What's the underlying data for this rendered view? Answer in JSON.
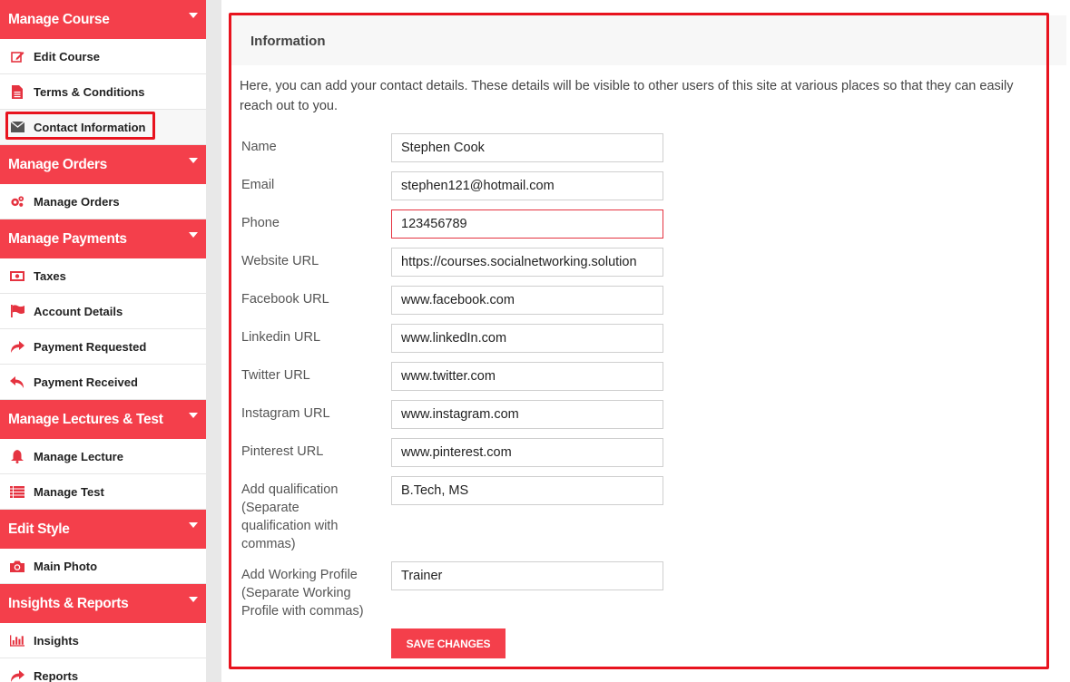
{
  "sidebar": {
    "sections": [
      {
        "title": "Manage Course",
        "items": [
          {
            "label": "Edit Course",
            "icon": "edit-icon"
          },
          {
            "label": "Terms & Conditions",
            "icon": "file-icon"
          },
          {
            "label": "Contact Information",
            "icon": "envelope-icon"
          }
        ]
      },
      {
        "title": "Manage Orders",
        "items": [
          {
            "label": "Manage Orders",
            "icon": "gears-icon"
          }
        ]
      },
      {
        "title": "Manage Payments",
        "items": [
          {
            "label": "Taxes",
            "icon": "money-icon"
          },
          {
            "label": "Account Details",
            "icon": "flag-icon"
          },
          {
            "label": "Payment Requested",
            "icon": "share-icon"
          },
          {
            "label": "Payment Received",
            "icon": "reply-icon"
          }
        ]
      },
      {
        "title": "Manage Lectures & Test",
        "items": [
          {
            "label": "Manage Lecture",
            "icon": "bell-icon"
          },
          {
            "label": "Manage Test",
            "icon": "list-icon"
          }
        ]
      },
      {
        "title": "Edit Style",
        "items": [
          {
            "label": "Main Photo",
            "icon": "camera-icon"
          }
        ]
      },
      {
        "title": "Insights & Reports",
        "items": [
          {
            "label": "Insights",
            "icon": "bar-chart-icon"
          },
          {
            "label": "Reports",
            "icon": "share-icon"
          }
        ]
      }
    ]
  },
  "main": {
    "title": "Information",
    "intro": "Here, you can add your contact details. These details will be visible to other users of this site at various places so that they can easily reach out to you.",
    "fields": {
      "name": {
        "label": "Name",
        "value": "Stephen Cook"
      },
      "email": {
        "label": "Email",
        "value": "stephen121@hotmail.com"
      },
      "phone": {
        "label": "Phone",
        "value": "123456789"
      },
      "website": {
        "label": "Website URL",
        "value": "https://courses.socialnetworking.solution"
      },
      "facebook": {
        "label": "Facebook URL",
        "value": "www.facebook.com"
      },
      "linkedin": {
        "label": "Linkedin URL",
        "value": "www.linkedIn.com"
      },
      "twitter": {
        "label": "Twitter URL",
        "value": "www.twitter.com"
      },
      "instagram": {
        "label": "Instagram URL",
        "value": "www.instagram.com"
      },
      "pinterest": {
        "label": "Pinterest URL",
        "value": "www.pinterest.com"
      },
      "qualification": {
        "label_lines": [
          "Add qualification",
          "(Separate",
          "qualification with",
          "commas)"
        ],
        "value": "B.Tech, MS"
      },
      "working_profile": {
        "label_lines": [
          "Add Working Profile",
          "(Separate Working",
          "Profile with commas)"
        ],
        "value": "Trainer"
      }
    },
    "save_label": "SAVE CHANGES"
  },
  "colors": {
    "accent": "#f43f4b",
    "highlight_border": "#e8131e"
  }
}
